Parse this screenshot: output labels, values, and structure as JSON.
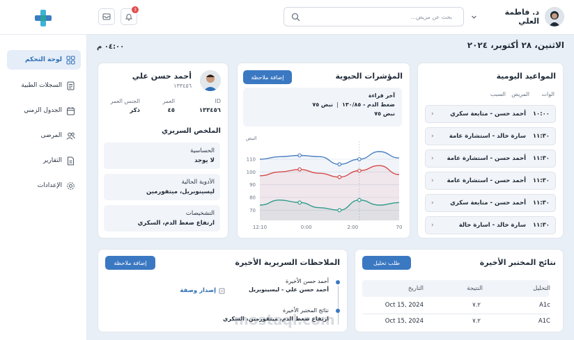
{
  "header": {
    "user_name": "د. فاطمة العلي",
    "search_placeholder": "بحث عن مريض...",
    "notification_count": "3"
  },
  "sidebar": {
    "items": [
      {
        "label": "لوحة التحكم",
        "icon": "grid-icon",
        "active": true
      },
      {
        "label": "السجلات الطبية",
        "icon": "document-icon"
      },
      {
        "label": "الجدول الزمني",
        "icon": "calendar-icon"
      },
      {
        "label": "المرضى",
        "icon": "users-icon"
      },
      {
        "label": "التقارير",
        "icon": "report-icon"
      },
      {
        "label": "الإعدادات",
        "icon": "gear-icon"
      }
    ]
  },
  "page": {
    "date": "الاثنين، ٢٨ أكتوبر، ٢٠٢٤",
    "time": "٠٤:٠٠ م"
  },
  "appointments": {
    "title": "المواعيد اليومية",
    "headers": {
      "time": "الوات",
      "patient": "المريض",
      "reason": "السبب"
    },
    "rows": [
      {
        "time": "١٠:٠٠",
        "text": "أحمد حسن - متابعة سكري"
      },
      {
        "time": "١١:٣٠",
        "text": "سارة خالد - استشارة عامة"
      },
      {
        "time": "١١:٣٠",
        "text": "أحمد حسن - استشارة عامة"
      },
      {
        "time": "١١:٣٠",
        "text": "أحمد حسن - استشارة عامة"
      },
      {
        "time": "١١:٣٠",
        "text": "أحمد حسن - متابعة سكري"
      },
      {
        "time": "١١:٣٠",
        "text": "سارة خالد - اسارة حالة"
      }
    ]
  },
  "vitals": {
    "title": "المؤشرات الحيوية",
    "add_note": "إضافة ملاحظة",
    "latest_label": "آخر قراءة",
    "bp_line": "ضغط الدم - ١٣٠/٨٥",
    "pulse_inline": "نبض ٧٥",
    "pulse_line": "نبض ٧٥",
    "y_axis_label": "النبض"
  },
  "chart_data": {
    "type": "line",
    "x": [
      "12:10",
      "1:00",
      "2:00",
      "3:00",
      "4:00",
      "5:00",
      "6:00",
      "7:00"
    ],
    "x_tick_labels": [
      "12:10",
      "0:00",
      "2:00",
      "70"
    ],
    "yticks": [
      70,
      80,
      90,
      100,
      110
    ],
    "ylim": [
      62,
      122
    ],
    "ylabel": "النبض",
    "series": [
      {
        "color": "#4a7fc1",
        "values": [
          110,
          112,
          113,
          112,
          106,
          110,
          116,
          111
        ]
      },
      {
        "color": "#d64a4a",
        "values": [
          97,
          100,
          102,
          99,
          96,
          101,
          105,
          98
        ]
      },
      {
        "color": "#2e9a8a",
        "values": [
          74,
          78,
          76,
          72,
          70,
          78,
          74,
          76
        ]
      }
    ],
    "grid": true
  },
  "patient": {
    "name": "أحمد حسن علي",
    "id_short": "١٣٣٤٥٦",
    "labels": {
      "id": "ID",
      "age": "العمر",
      "gender": "الجنس العمر"
    },
    "values": {
      "id": "١٣٣٤٥٦",
      "age": "٤٥",
      "gender": "ذكر"
    },
    "summary_title": "الملخص السريري",
    "summary": [
      {
        "key": "الحساسية",
        "value": "لا يوجد"
      },
      {
        "key": "الأدوية الحالية",
        "value": "ليسينوبريل، ميتفورمين"
      },
      {
        "key": "التشخيصات",
        "value": "ارتفاع ضغط الدم، السكري"
      }
    ]
  },
  "notes": {
    "title": "الملاحظات السريرية الأخيرة",
    "add_note": "إضافة ملاحظة",
    "items": [
      {
        "line1": "أحمد حسن الأخيرة",
        "line2": "أحمد حسن علي - ليسينوبريل",
        "action": "إصدار وصفة"
      },
      {
        "line1": "نتائج المختبر الأخيرة",
        "line2": "ارتفاع ضغط الدم، ميتفورمين، السكري"
      }
    ]
  },
  "labs": {
    "title": "نتائج المختبر الأخيرة",
    "request_btn": "طلب تحليل",
    "columns": [
      "التحليل",
      "النتيجة",
      "التاريخ"
    ],
    "rows": [
      {
        "test": "A1c",
        "result": "٧.٢",
        "date": "Oct 15, 2024"
      },
      {
        "test": "A1C",
        "result": "٧.٢",
        "date": "Oct 15, 2024"
      }
    ]
  },
  "watermark": "mostaql.com"
}
